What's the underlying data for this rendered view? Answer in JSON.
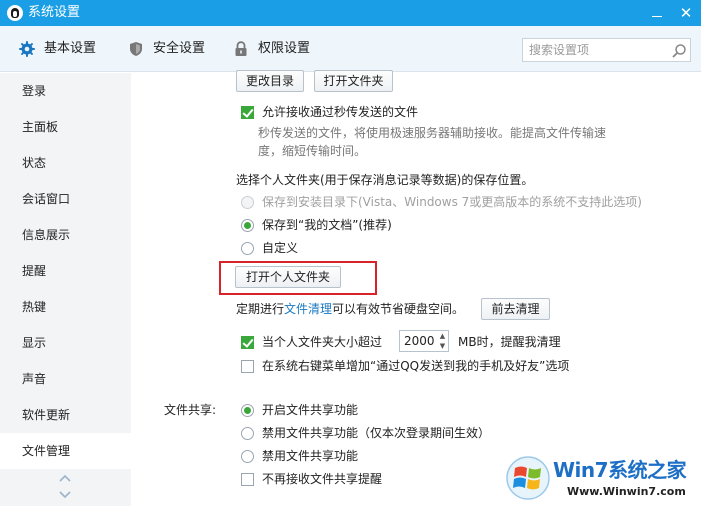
{
  "window": {
    "title": "系统设置",
    "minimize_label": "—",
    "close_label": "✕"
  },
  "tabs": [
    {
      "label": "基本设置",
      "icon": "gear-icon"
    },
    {
      "label": "安全设置",
      "icon": "shield-icon"
    },
    {
      "label": "权限设置",
      "icon": "lock-icon"
    }
  ],
  "search": {
    "placeholder": "搜索设置项"
  },
  "sidebar": {
    "items": [
      "登录",
      "主面板",
      "状态",
      "会话窗口",
      "信息展示",
      "提醒",
      "热键",
      "显示",
      "声音",
      "软件更新",
      "文件管理"
    ],
    "active": "文件管理"
  },
  "content": {
    "change_dir_button": "更改目录",
    "open_folder_button": "打开文件夹",
    "allow_receive_label": "允许接收通过秒传发送的文件",
    "allow_receive_desc_1": "秒传发送的文件，将使用极速服务器辅助接收。能提高文件传输速",
    "allow_receive_desc_2": "度，缩短传输时间。",
    "personal_folder_heading": "选择个人文件夹(用于保存消息记录等数据)的保存位置。",
    "option_install_dir": "保存到安装目录下(Vista、Windows 7或更高版本的系统不支持此选项)",
    "option_my_docs": "保存到“我的文档”(推荐)",
    "option_custom": "自定义",
    "open_personal_folder_button": "打开个人文件夹",
    "cleanup_prefix": "定期进行",
    "cleanup_link": "文件清理",
    "cleanup_suffix": "可以有效节省硬盘空间。",
    "cleanup_button": "前去清理",
    "size_limit_label": "当个人文件夹大小超过",
    "size_limit_value": "2000",
    "size_limit_unit": "MB时，提醒我清理",
    "context_menu_label": "在系统右键菜单增加“通过QQ发送到我的手机及好友”选项",
    "file_share_label": "文件共享:",
    "share_enable": "开启文件共享功能",
    "share_disable_once": "禁用文件共享功能（仅本次登录期间生效）",
    "share_disable": "禁用文件共享功能",
    "share_no_remind": "不再接收文件共享提醒"
  },
  "watermark": {
    "brand": "Win7系统之家",
    "url": "Www.Winwin7.com"
  },
  "colors": {
    "titlebar": "#1a9ee6",
    "accent_green": "#3aa73a",
    "highlight_red": "#d9232b",
    "link": "#1a78c2"
  }
}
